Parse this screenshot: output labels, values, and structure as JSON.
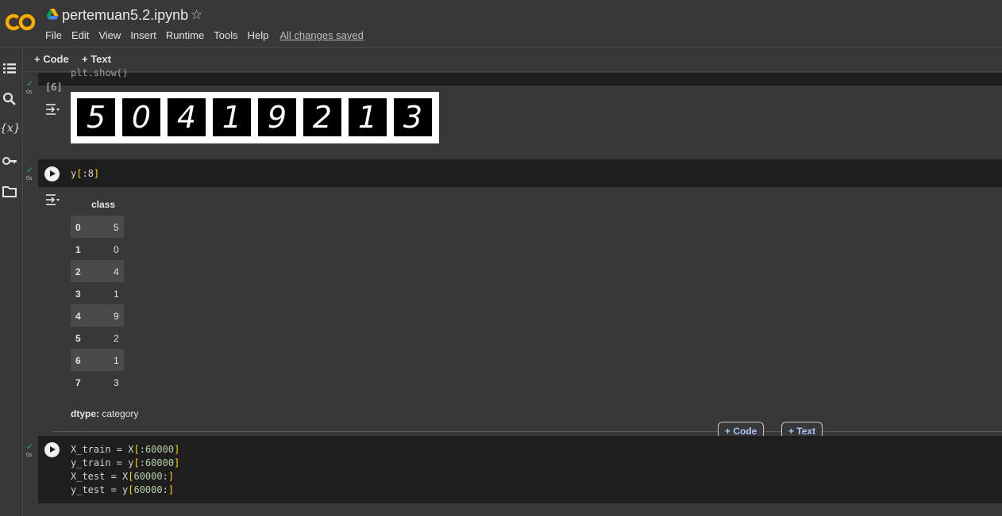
{
  "header": {
    "title": "pertemuan5.2.ipynb",
    "menu": [
      "File",
      "Edit",
      "View",
      "Insert",
      "Runtime",
      "Tools",
      "Help"
    ],
    "save_status": "All changes saved"
  },
  "toolbar": {
    "code_label": "+ Code",
    "text_label": "+ Text"
  },
  "cells": {
    "c1": {
      "partial_code": "plt.show()",
      "exec_count": "[6]",
      "time": "0s",
      "digits": [
        "5",
        "0",
        "4",
        "1",
        "9",
        "2",
        "1",
        "3"
      ]
    },
    "c2": {
      "code": "y[:8]",
      "time": "0s"
    },
    "c3": {
      "time": "0s",
      "lines": [
        "X_train = X[:60000]",
        "y_train = y[:60000]",
        "X_test = X[60000:]",
        "y_test = y[60000:]"
      ]
    }
  },
  "dataframe": {
    "header": "class",
    "rows": [
      {
        "index": "0",
        "value": "5"
      },
      {
        "index": "1",
        "value": "0"
      },
      {
        "index": "2",
        "value": "4"
      },
      {
        "index": "3",
        "value": "1"
      },
      {
        "index": "4",
        "value": "9"
      },
      {
        "index": "5",
        "value": "2"
      },
      {
        "index": "6",
        "value": "1"
      },
      {
        "index": "7",
        "value": "3"
      }
    ],
    "dtype_label": "dtype:",
    "dtype_value": "category"
  },
  "add_buttons": {
    "code": "+ Code",
    "text": "+ Text"
  },
  "colors": {
    "accent_orange": "#f9ab00",
    "check_green": "#34a853",
    "link_blue": "#a8c7fa"
  }
}
